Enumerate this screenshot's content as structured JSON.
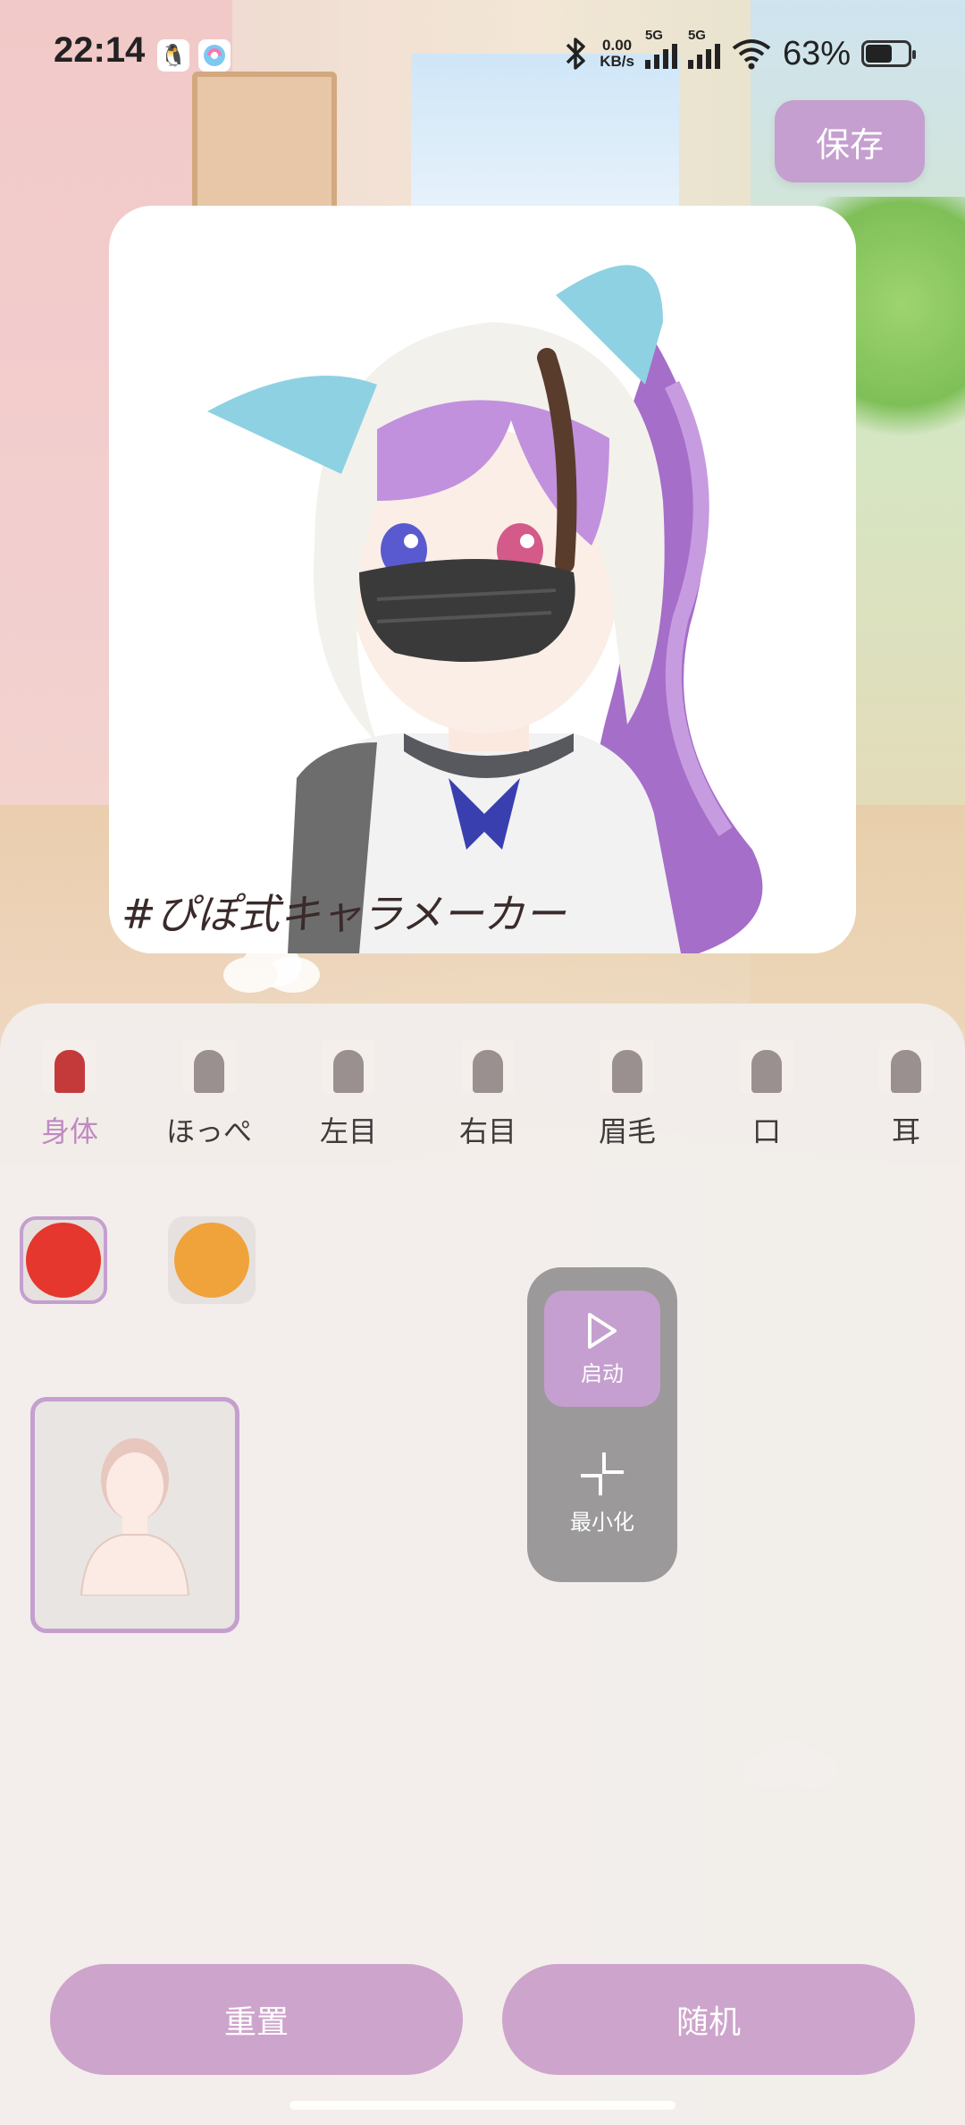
{
  "status_bar": {
    "time": "22:14",
    "net_speed_value": "0.00",
    "net_speed_unit": "KB/s",
    "signal1_tag": "5G",
    "signal2_tag": "5G",
    "battery_percent": "63%",
    "battery_level": 0.63,
    "icons": [
      "qq-icon",
      "app-badge-icon",
      "bluetooth-icon",
      "signal-icon",
      "wifi-icon",
      "battery-icon"
    ]
  },
  "toolbar": {
    "save_label": "保存"
  },
  "preview": {
    "watermark": "#ぴぽ式キャラメーカー"
  },
  "categories": [
    {
      "label": "身体",
      "active": true
    },
    {
      "label": "ほっぺ",
      "active": false
    },
    {
      "label": "左目",
      "active": false
    },
    {
      "label": "右目",
      "active": false
    },
    {
      "label": "眉毛",
      "active": false
    },
    {
      "label": "口",
      "active": false
    },
    {
      "label": "耳",
      "active": false
    }
  ],
  "colors": [
    {
      "hex": "#e5372d",
      "selected": true
    },
    {
      "hex": "#f0a33b",
      "selected": false
    }
  ],
  "floating_control": {
    "start_label": "启动",
    "minimize_label": "最小化"
  },
  "actions": {
    "reset_label": "重置",
    "random_label": "随机"
  },
  "theme": {
    "accent": "#c59fcf",
    "panel_bg": "#f2eeec",
    "control_bg": "#9b9999"
  }
}
